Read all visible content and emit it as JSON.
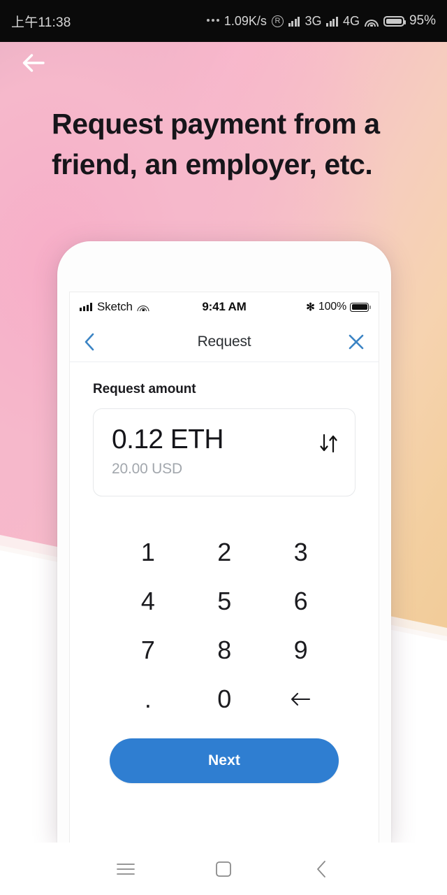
{
  "system_status_bar": {
    "clock": "上午11:38",
    "network_speed": "1.09K/s",
    "roaming_icon": "R",
    "network_label_1": "3G",
    "network_label_2": "4G",
    "battery_percent": "95%"
  },
  "hero": {
    "back_icon": "arrow-left-icon",
    "title": "Request payment from a friend, an employer, etc."
  },
  "phone": {
    "ios_status": {
      "carrier": "Sketch",
      "time": "9:41 AM",
      "battery_percent": "100%",
      "bluetooth_icon": "✻"
    },
    "navbar": {
      "back_icon": "chevron-left-icon",
      "title": "Request",
      "close_icon": "close-icon"
    },
    "content": {
      "section_label": "Request amount",
      "amount_primary": "0.12 ETH",
      "amount_secondary": "20.00 USD",
      "swap_icon": "swap-vertical-icon"
    },
    "keypad": [
      {
        "label": "1",
        "name": "key-1"
      },
      {
        "label": "2",
        "name": "key-2"
      },
      {
        "label": "3",
        "name": "key-3"
      },
      {
        "label": "4",
        "name": "key-4"
      },
      {
        "label": "5",
        "name": "key-5"
      },
      {
        "label": "6",
        "name": "key-6"
      },
      {
        "label": "7",
        "name": "key-7"
      },
      {
        "label": "8",
        "name": "key-8"
      },
      {
        "label": "9",
        "name": "key-9"
      },
      {
        "label": ".",
        "name": "key-decimal"
      },
      {
        "label": "0",
        "name": "key-0"
      },
      {
        "label": "←",
        "name": "key-backspace"
      }
    ],
    "next_button": "Next"
  },
  "android_nav": {
    "recents_icon": "menu-icon",
    "home_icon": "square-icon",
    "back_icon": "chevron-left-icon"
  },
  "colors": {
    "accent_blue": "#2f7ed1",
    "nav_blue": "#3b84c4",
    "gradient_pink": "#f9b6cc",
    "gradient_peach": "#f0c78f",
    "text_dark": "#16151a",
    "text_muted": "#a2a7ad"
  }
}
